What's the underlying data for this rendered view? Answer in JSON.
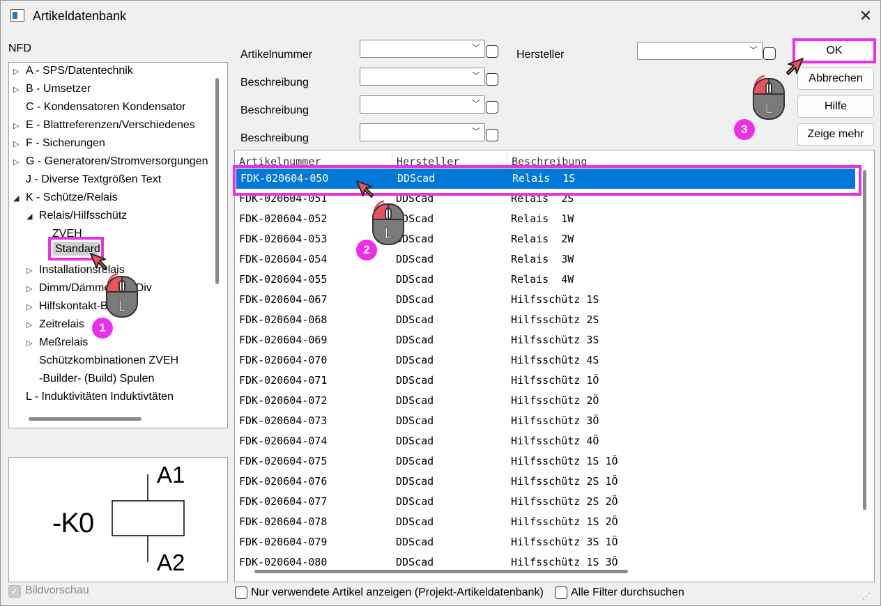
{
  "window": {
    "title": "Artikeldatenbank",
    "close_glyph": "✕",
    "icon": "app-window-icon"
  },
  "tree": {
    "root_label": "NFD",
    "nodes": [
      {
        "label": "A - SPS/Datentechnik",
        "expander": "▷"
      },
      {
        "label": "B - Umsetzer",
        "expander": "▷"
      },
      {
        "label": "C - Kondensatoren Kondensator",
        "expander": ""
      },
      {
        "label": "E - Blattreferenzen/Verschiedenes",
        "expander": "▷"
      },
      {
        "label": "F - Sicherungen",
        "expander": "▷"
      },
      {
        "label": "G - Generatoren/Stromversorgungen",
        "expander": "▷"
      },
      {
        "label": "J - Diverse Textgrößen Text",
        "expander": ""
      },
      {
        "label": "K - Schütze/Relais",
        "expander": "◢"
      },
      {
        "label": "Relais/Hilfsschütz",
        "expander": "◢"
      },
      {
        "label": "ZVEH",
        "expander": ""
      },
      {
        "label": "Standard",
        "expander": ""
      },
      {
        "label": "Installationsrelais",
        "expander": "▷"
      },
      {
        "label": "Dimm/Dämmerung/Div",
        "expander": "▷"
      },
      {
        "label": "Hilfskontakt-Block",
        "expander": "▷"
      },
      {
        "label": "Zeitrelais",
        "expander": "▷"
      },
      {
        "label": "Meßrelais",
        "expander": "▷"
      },
      {
        "label": "Schützkombinationen ZVEH",
        "expander": ""
      },
      {
        "label": "-Builder- (Build) Spulen",
        "expander": ""
      },
      {
        "label": "L - Induktivitäten Induktivtäten",
        "expander": ""
      }
    ]
  },
  "preview": {
    "ref": "-K0",
    "pin_top": "A1",
    "pin_bottom": "A2",
    "checkbox_label": "Bildvorschau",
    "checkbox_checked": true,
    "check_glyph": "✓"
  },
  "filters": {
    "artikelnummer_label": "Artikelnummer",
    "beschreibung_label_1": "Beschreibung",
    "beschreibung_label_2": "Beschreibung",
    "beschreibung_label_3": "Beschreibung",
    "hersteller_label": "Hersteller",
    "chevron": "﹀"
  },
  "buttons": {
    "ok": "OK",
    "cancel": "Abbrechen",
    "help": "Hilfe",
    "more": "Zeige mehr"
  },
  "table": {
    "columns": [
      "Artikelnummer",
      "Hersteller",
      "Beschreibung"
    ],
    "selected_index": 0,
    "rows": [
      [
        "FDK-020604-050",
        "DDScad",
        "Relais  1S"
      ],
      [
        "FDK-020604-051",
        "DDScad",
        "Relais  2S"
      ],
      [
        "FDK-020604-052",
        "DDScad",
        "Relais  1W"
      ],
      [
        "FDK-020604-053",
        "DDScad",
        "Relais  2W"
      ],
      [
        "FDK-020604-054",
        "DDScad",
        "Relais  3W"
      ],
      [
        "FDK-020604-055",
        "DDScad",
        "Relais  4W"
      ],
      [
        "FDK-020604-067",
        "DDScad",
        "Hilfsschütz 1S"
      ],
      [
        "FDK-020604-068",
        "DDScad",
        "Hilfsschütz 2S"
      ],
      [
        "FDK-020604-069",
        "DDScad",
        "Hilfsschütz 3S"
      ],
      [
        "FDK-020604-070",
        "DDScad",
        "Hilfsschütz 4S"
      ],
      [
        "FDK-020604-071",
        "DDScad",
        "Hilfsschütz 1Ö"
      ],
      [
        "FDK-020604-072",
        "DDScad",
        "Hilfsschütz 2Ö"
      ],
      [
        "FDK-020604-073",
        "DDScad",
        "Hilfsschütz 3Ö"
      ],
      [
        "FDK-020604-074",
        "DDScad",
        "Hilfsschütz 4Ö"
      ],
      [
        "FDK-020604-075",
        "DDScad",
        "Hilfsschütz 1S 1Ö"
      ],
      [
        "FDK-020604-076",
        "DDScad",
        "Hilfsschütz 2S 1Ö"
      ],
      [
        "FDK-020604-077",
        "DDScad",
        "Hilfsschütz 2S 2Ö"
      ],
      [
        "FDK-020604-078",
        "DDScad",
        "Hilfsschütz 1S 2Ö"
      ],
      [
        "FDK-020604-079",
        "DDScad",
        "Hilfsschütz 3S 1Ö"
      ],
      [
        "FDK-020604-080",
        "DDScad",
        "Hilfsschütz 1S 3Ö"
      ]
    ]
  },
  "bottom": {
    "only_used_label": "Nur verwendete Artikel anzeigen (Projekt-Artikeldatenbank)",
    "all_filters_label": "Alle Filter durchsuchen"
  },
  "annotations": {
    "step1": "1",
    "step2": "2",
    "step3": "3",
    "mouse_button": "L"
  },
  "colors": {
    "highlight": "#ee2ee8",
    "selection": "#0078d7",
    "mouse_red": "#e8545a",
    "mouse_gray": "#7a7a7a"
  }
}
